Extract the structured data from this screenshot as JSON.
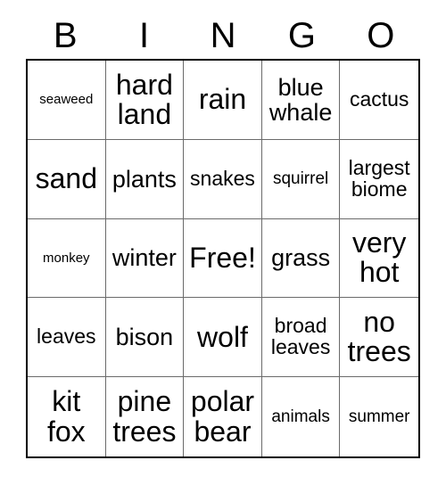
{
  "card": {
    "title": "BINGO",
    "headers": [
      "B",
      "I",
      "N",
      "G",
      "O"
    ],
    "grid_line_color": "#6b6b6b",
    "border_color": "#000000",
    "background_color": "#ffffff",
    "text_color": "#000000",
    "rows": [
      [
        {
          "label": "seaweed",
          "size": "fs-xs",
          "free": false
        },
        {
          "label": "hard\nland",
          "size": "fs-xl",
          "free": false
        },
        {
          "label": "rain",
          "size": "fs-xl",
          "free": false
        },
        {
          "label": "blue\nwhale",
          "size": "fs-lg",
          "free": false
        },
        {
          "label": "cactus",
          "size": "fs-md",
          "free": false
        }
      ],
      [
        {
          "label": "sand",
          "size": "fs-xl",
          "free": false
        },
        {
          "label": "plants",
          "size": "fs-lg",
          "free": false
        },
        {
          "label": "snakes",
          "size": "fs-md",
          "free": false
        },
        {
          "label": "squirrel",
          "size": "fs-sm",
          "free": false
        },
        {
          "label": "largest\nbiome",
          "size": "fs-md",
          "free": false
        }
      ],
      [
        {
          "label": "monkey",
          "size": "fs-xs",
          "free": false
        },
        {
          "label": "winter",
          "size": "fs-lg",
          "free": false
        },
        {
          "label": "Free!",
          "size": "fs-xl",
          "free": true
        },
        {
          "label": "grass",
          "size": "fs-lg",
          "free": false
        },
        {
          "label": "very\nhot",
          "size": "fs-xl",
          "free": false
        }
      ],
      [
        {
          "label": "leaves",
          "size": "fs-md",
          "free": false
        },
        {
          "label": "bison",
          "size": "fs-lg",
          "free": false
        },
        {
          "label": "wolf",
          "size": "fs-xl",
          "free": false
        },
        {
          "label": "broad\nleaves",
          "size": "fs-md",
          "free": false
        },
        {
          "label": "no\ntrees",
          "size": "fs-xl",
          "free": false
        }
      ],
      [
        {
          "label": "kit\nfox",
          "size": "fs-xl",
          "free": false
        },
        {
          "label": "pine\ntrees",
          "size": "fs-xl",
          "free": false
        },
        {
          "label": "polar\nbear",
          "size": "fs-xl",
          "free": false
        },
        {
          "label": "animals",
          "size": "fs-sm",
          "free": false
        },
        {
          "label": "summer",
          "size": "fs-sm",
          "free": false
        }
      ]
    ]
  }
}
